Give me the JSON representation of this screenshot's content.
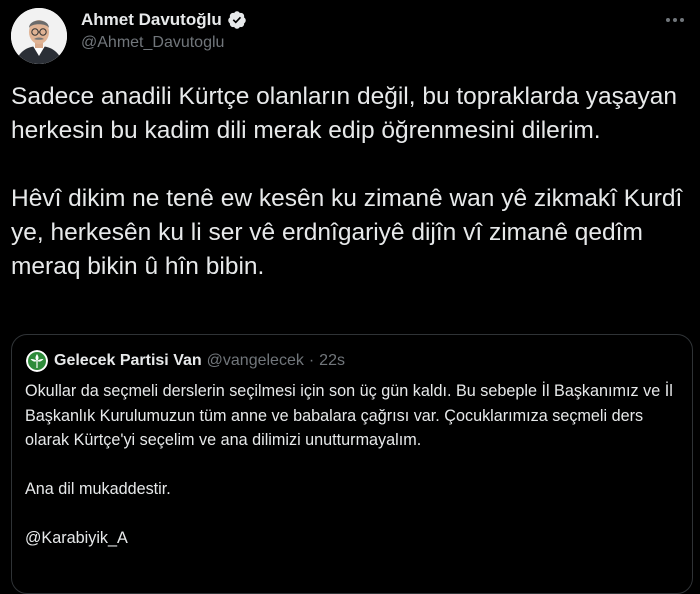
{
  "author": {
    "name": "Ahmet Davutoğlu",
    "handle": "@Ahmet_Davutoglu",
    "verified": true,
    "avatar_icon": "profile-photo"
  },
  "tweet": {
    "text": "Sadece anadili Kürtçe olanların değil, bu topraklarda yaşayan herkesin bu kadim dili merak edip öğrenmesini dilerim.\n\nHêvî dikim ne tenê ew kesên ku zimanê wan yê zikmakî Kurdî ye, herkesên ku li ser vê erdnîgariyê dijîn vî zimanê qedîm meraq bikin û hîn bibin."
  },
  "quoted_tweet": {
    "name": "Gelecek Partisi Van",
    "handle": "@vangelecek",
    "separator": "·",
    "time": "22s",
    "avatar_icon": "party-logo",
    "text": "Okullar da seçmeli derslerin seçilmesi için son üç gün kaldı. Bu sebeple İl Başkanımız ve İl Başkanlık Kurulumuzun tüm anne ve babalara çağrısı var. Çocuklarımıza seçmeli ders olarak Kürtçe'yi seçelim ve ana dilimizi unutturmayalım.\n\nAna dil mukaddestir.\n\n@Karabiyik_A"
  },
  "colors": {
    "background": "#000000",
    "text_primary": "#e7e9ea",
    "text_secondary": "#71767b",
    "border": "#2f3336",
    "party_green": "#2e8b3a"
  }
}
